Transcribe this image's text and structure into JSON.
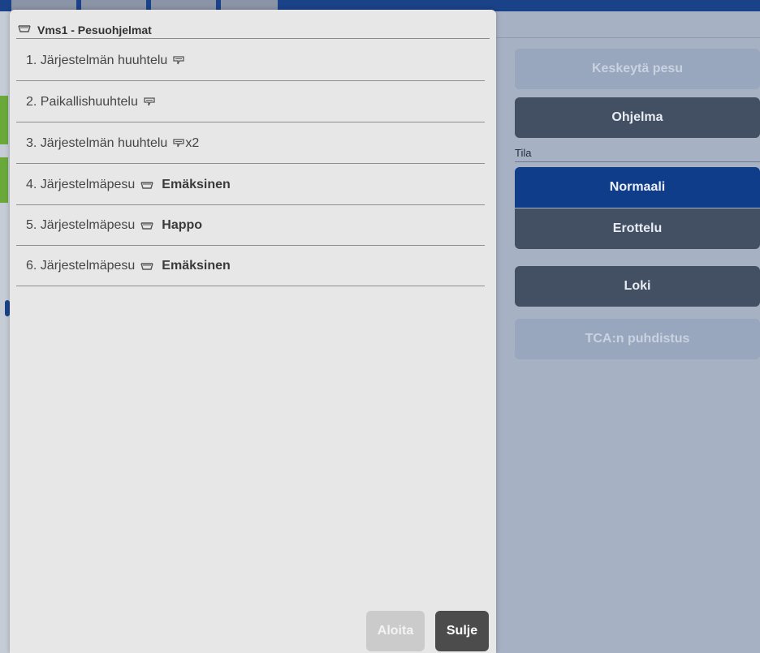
{
  "modal": {
    "title": "Vms1 - Pesuohjelmat",
    "title_icon": "wash-basin-icon",
    "programs": [
      {
        "label": "1. Järjestelmän huuhtelu",
        "icon": "rinse-icon",
        "multiplier": "",
        "chemical": ""
      },
      {
        "label": "2. Paikallishuuhtelu",
        "icon": "rinse-icon",
        "multiplier": "",
        "chemical": ""
      },
      {
        "label": "3. Järjestelmän huuhtelu",
        "icon": "rinse-icon",
        "multiplier": "x2",
        "chemical": ""
      },
      {
        "label": "4. Järjestelmäpesu",
        "icon": "wash-basin-icon",
        "multiplier": "",
        "chemical": "Emäksinen"
      },
      {
        "label": "5. Järjestelmäpesu",
        "icon": "wash-basin-icon",
        "multiplier": "",
        "chemical": "Happo"
      },
      {
        "label": "6. Järjestelmäpesu",
        "icon": "wash-basin-icon",
        "multiplier": "",
        "chemical": "Emäksinen"
      }
    ],
    "start_label": "Aloita",
    "close_label": "Sulje"
  },
  "right_panel": {
    "stop_wash_label": "Keskeytä pesu",
    "program_label": "Ohjelma",
    "mode_heading": "Tila",
    "mode_normal_label": "Normaali",
    "mode_separation_label": "Erottelu",
    "log_label": "Loki",
    "tca_cleaning_label": "TCA:n puhdistus"
  },
  "colors": {
    "accent_blue": "#0f3d8a",
    "dark_button": "#434f62",
    "disabled_button": "#98a6be",
    "modal_bg": "#e7e7e7"
  }
}
